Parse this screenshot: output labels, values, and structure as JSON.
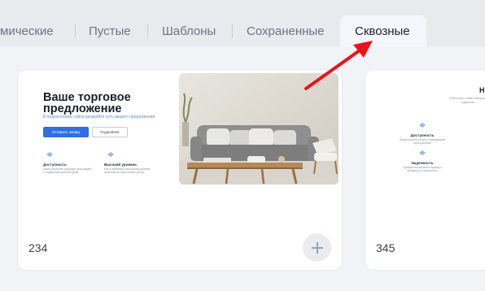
{
  "tabs": {
    "dynamic": "мические",
    "empty": "Пустые",
    "templates": "Шаблоны",
    "saved": "Сохраненные",
    "through": "Сквозные"
  },
  "cards": [
    {
      "number": "234",
      "preview": {
        "title": "Ваше торговое предложение",
        "subtitle": "В подзаголовке сайта раскройте суть вашего предложения",
        "primary_button": "Оставить заявку",
        "secondary_button": "Подробнее",
        "features": [
          {
            "title": "Доступность",
            "desc": "Наше решение подходит для людей с подвижной архитектурой"
          },
          {
            "title": "Высокий уровень",
            "desc": "Мы стремимся к высокому уровню качества во всех наших делах"
          }
        ]
      }
    },
    {
      "number": "345",
      "preview": {
        "title": "Н",
        "subtitle": "Работая с нами которое вдохнов",
        "features": [
          {
            "title": "Доступность",
            "desc": "Предложение услуг в подходящем пространстве"
          },
          {
            "title": "Надежность",
            "desc": "Профессиональный подход к процессу и надежность"
          }
        ]
      }
    }
  ],
  "colors": {
    "accent": "#2f6fe4",
    "arrow": "#e8141c",
    "tab_active_bg": "#f4f6fb",
    "tabbar_bg": "#e8eaee"
  }
}
